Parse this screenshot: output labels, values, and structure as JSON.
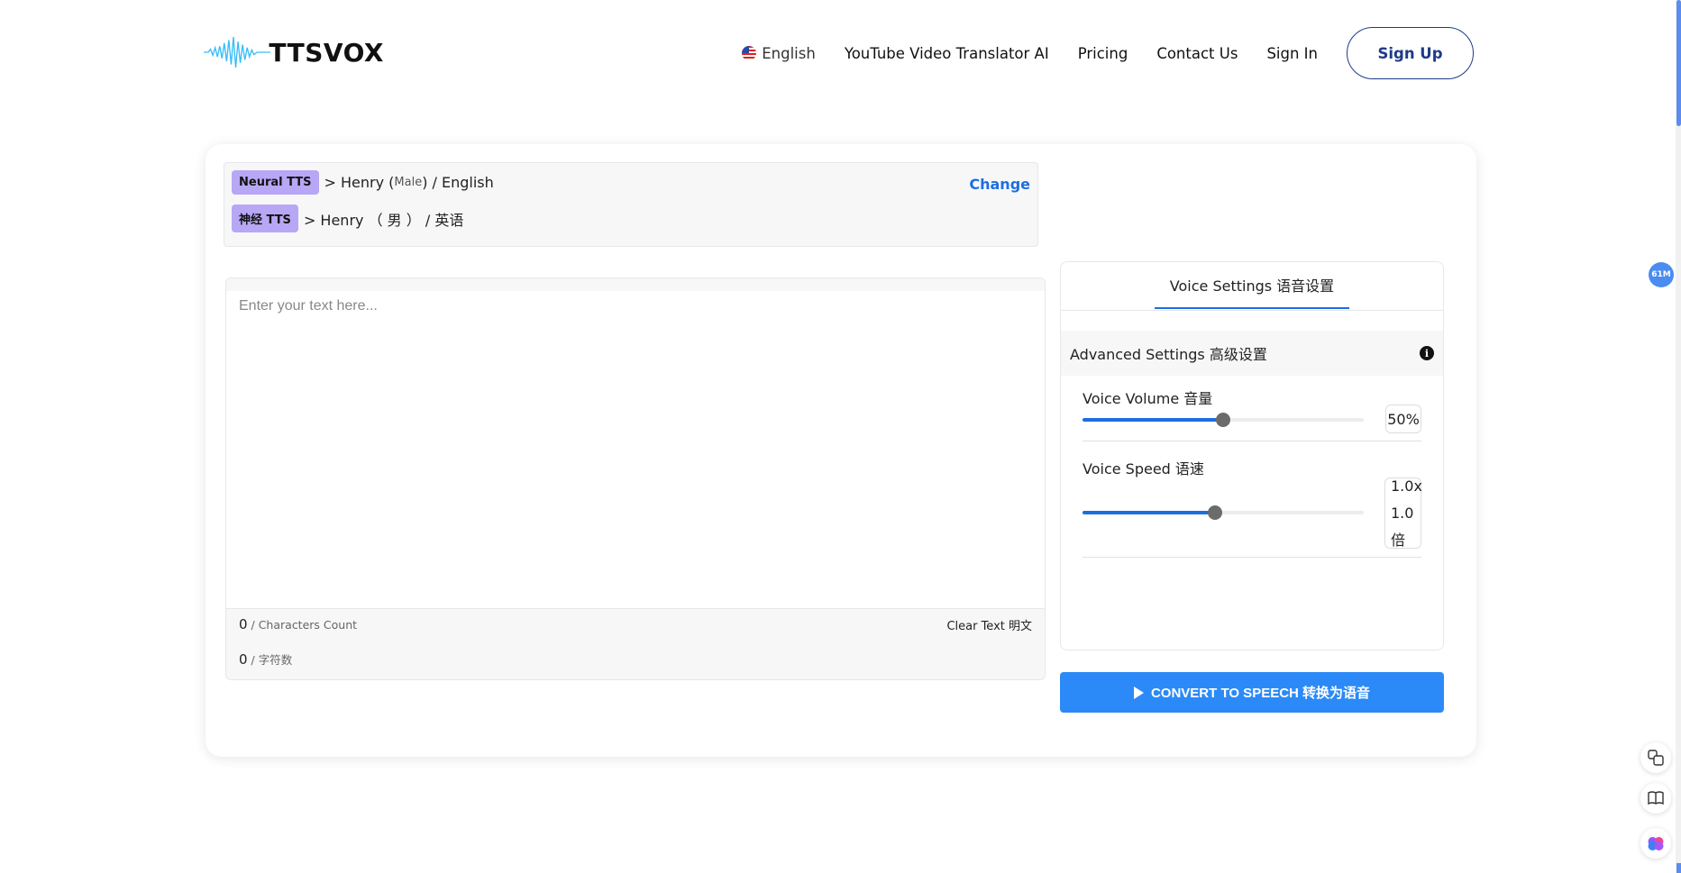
{
  "brand": {
    "name": "TTSVOX"
  },
  "nav": {
    "language": "English",
    "links": [
      "YouTube Video Translator AI",
      "Pricing",
      "Contact Us",
      "Sign In"
    ],
    "signup": "Sign Up"
  },
  "voice": {
    "tag_en": "Neural TTS",
    "line_en_prefix": "> Henry (",
    "line_en_gender": "Male",
    "line_en_suffix": ") / English",
    "tag_zh": "神经 TTS",
    "line_zh": "> Henry （ 男 ） / 英语",
    "change": "Change"
  },
  "editor": {
    "placeholder": "Enter your text here...",
    "count_en": "0",
    "count_en_label": " / Characters Count",
    "count_zh": "0",
    "count_zh_label": " / 字符数",
    "clear": "Clear Text 明文"
  },
  "settings": {
    "tab": "Voice Settings  语音设置",
    "advanced": "Advanced Settings 高级设置",
    "info_icon": "i",
    "volume": {
      "label": "Voice Volume 音量",
      "value": "50%",
      "fraction": 0.5
    },
    "speed": {
      "label": "Voice Speed 语速",
      "value_line1": "1.0x",
      "value_line2": "1.0",
      "value_line3": "倍",
      "fraction": 0.47
    }
  },
  "convert": {
    "label": "CONVERT TO SPEECH   转换为语音"
  },
  "side": {
    "badge": "61M",
    "icons": [
      "translate-icon",
      "book-icon",
      "brain-icon"
    ]
  },
  "colors": {
    "accent": "#1d6fe0",
    "button": "#2b8af7",
    "tag": "#b7a7f5"
  }
}
